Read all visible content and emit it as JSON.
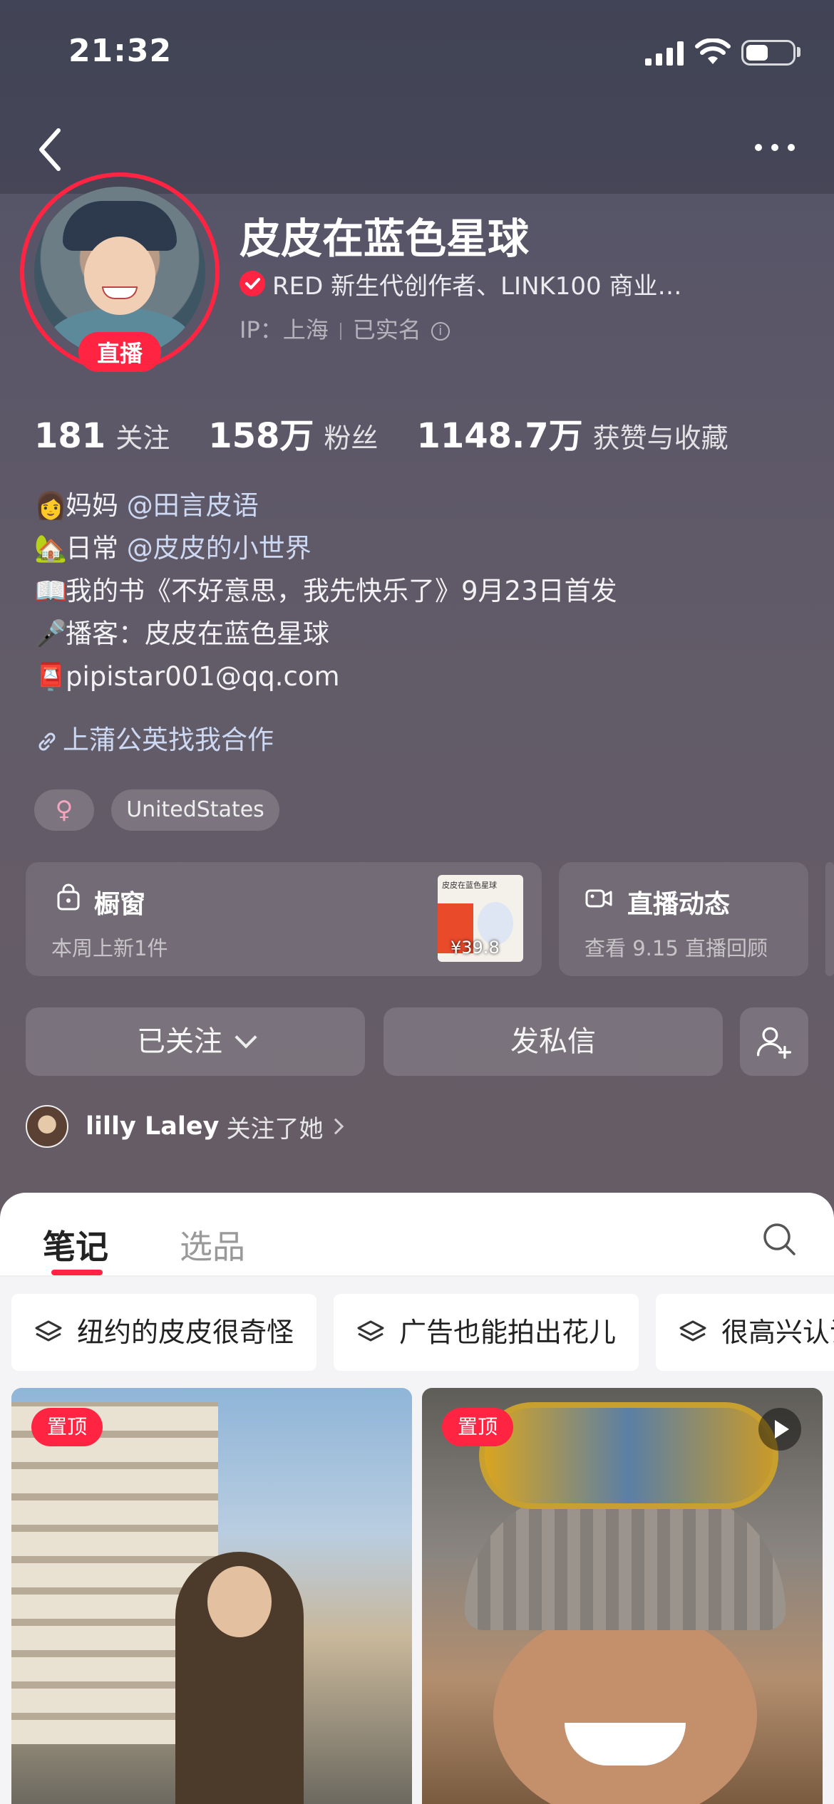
{
  "status_bar": {
    "time": "21:32"
  },
  "profile": {
    "username": "皮皮在蓝色星球",
    "live_badge": "直播",
    "verification": "RED 新生代创作者、LINK100 商业…",
    "ip_label": "IP：上海",
    "real_name": "已实名"
  },
  "stats": [
    {
      "value": "181",
      "label": "关注"
    },
    {
      "value": "158万",
      "label": "粉丝"
    },
    {
      "value": "1148.7万",
      "label": "获赞与收藏"
    }
  ],
  "bio": {
    "line1_text": "妈妈 ",
    "line1_mention": "@田言皮语",
    "line2_text": "日常 ",
    "line2_mention": "@皮皮的小世界",
    "line3": "我的书《不好意思，我先快乐了》9月23日首发",
    "line4": "播客：皮皮在蓝色星球",
    "line5": "pipistar001@qq.com",
    "collab_link": "上蒲公英找我合作"
  },
  "tags": {
    "gender": "♀",
    "location": "UnitedStates"
  },
  "cards": {
    "shop_title": "橱窗",
    "shop_sub": "本周上新1件",
    "shop_price": "¥39.8",
    "book_title": "皮皮在蓝色星球",
    "live_title": "直播动态",
    "live_sub": "查看 9.15 直播回顾"
  },
  "actions": {
    "follow": "已关注",
    "message": "发私信"
  },
  "follower": {
    "name": "lilly Laley",
    "text": "关注了她"
  },
  "tabs": {
    "notes": "笔记",
    "picks": "选品"
  },
  "collections": [
    "纽约的皮皮很奇怪",
    "广告也能拍出花儿",
    "很高兴认识"
  ],
  "feed": {
    "pin_label": "置顶"
  },
  "colors": {
    "accent": "#ff2442",
    "mention": "#cdd8f2"
  }
}
